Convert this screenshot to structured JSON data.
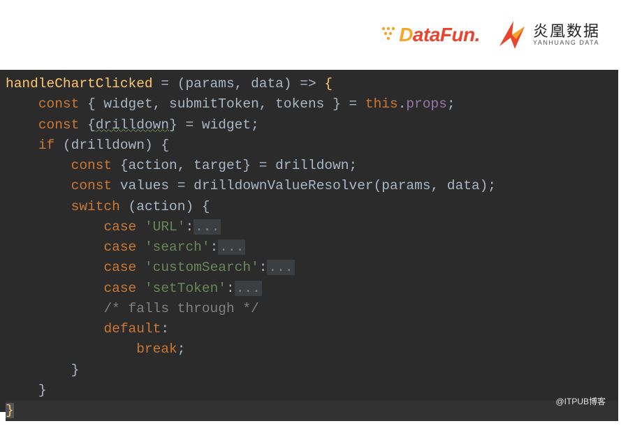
{
  "logos": {
    "datafun_d": "D",
    "datafun_rest": "ataFun",
    "datafun_dot": ".",
    "yanhuang_cn": "炎凰数据",
    "yanhuang_en": "YANHUANG DATA"
  },
  "code": {
    "l1_fn": "handleChartClicked",
    "l1_rest1": " = (",
    "l1_params": "params, data",
    "l1_rest2": ") => ",
    "l1_brace": "{",
    "l2_kw": "const",
    "l2_ids": " { widget, submitToken, tokens } = ",
    "l2_this": "this",
    "l2_dot": ".",
    "l2_props": "props",
    "l2_semi": ";",
    "l3_kw": "const",
    "l3_open": " {",
    "l3_drill": "drilldown",
    "l3_close": "} = widget;",
    "l4_kw": "if",
    "l4_cond": " (drilldown) {",
    "l5_kw": "const",
    "l5_rest": " {action, target} = drilldown;",
    "l6_kw": "const",
    "l6_rest": " values = drilldownValueResolver(params, data);",
    "l7_kw": "switch",
    "l7_rest": " (action) {",
    "l8_kw": "case",
    "l8_str": "'URL'",
    "l8_colon": ":",
    "l8_fold": "...",
    "l9_kw": "case",
    "l9_str": "'search'",
    "l9_colon": ":",
    "l9_fold": "...",
    "l10_kw": "case",
    "l10_str": "'customSearch'",
    "l10_colon": ":",
    "l10_fold": "...",
    "l11_kw": "case",
    "l11_str": "'setToken'",
    "l11_colon": ":",
    "l11_fold": "...",
    "l12_cmt": "/* falls through */",
    "l13_kw": "default",
    "l13_colon": ":",
    "l14_kw": "break",
    "l14_semi": ";",
    "l15_brace": "}",
    "l16_brace": "}",
    "l17_brace": "}"
  },
  "watermark": "@ITPUB博客"
}
